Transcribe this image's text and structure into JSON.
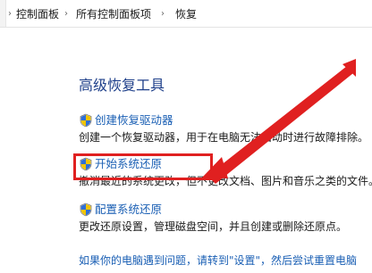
{
  "address_bar": {
    "breadcrumbs": [
      "控制面板",
      "所有控制面板项",
      "恢复"
    ],
    "separator_icon": "chevron-right"
  },
  "main": {
    "section_title": "高级恢复工具",
    "items": [
      {
        "label": "创建恢复驱动器",
        "description": "创建一个恢复驱动器，用于在电脑无法启动时进行故障排除。",
        "icon": "uac-shield-icon"
      },
      {
        "label": "开始系统还原",
        "description": "撤消最近的系统更改，但不更改文档、图片和音乐之类的文件。",
        "icon": "uac-shield-icon",
        "highlighted": true
      },
      {
        "label": "配置系统还原",
        "description": "更改还原设置，管理磁盘空间，并且创建或删除还原点。",
        "icon": "uac-shield-icon"
      }
    ],
    "bottom_link": "如果你的电脑遇到问题，请转到\"设置\"，然后尝试重置电脑"
  },
  "annotation": {
    "color": "#e02020"
  },
  "colors": {
    "link": "#1a5fb4",
    "title": "#1e3f8a",
    "text": "#1a1a1a"
  }
}
